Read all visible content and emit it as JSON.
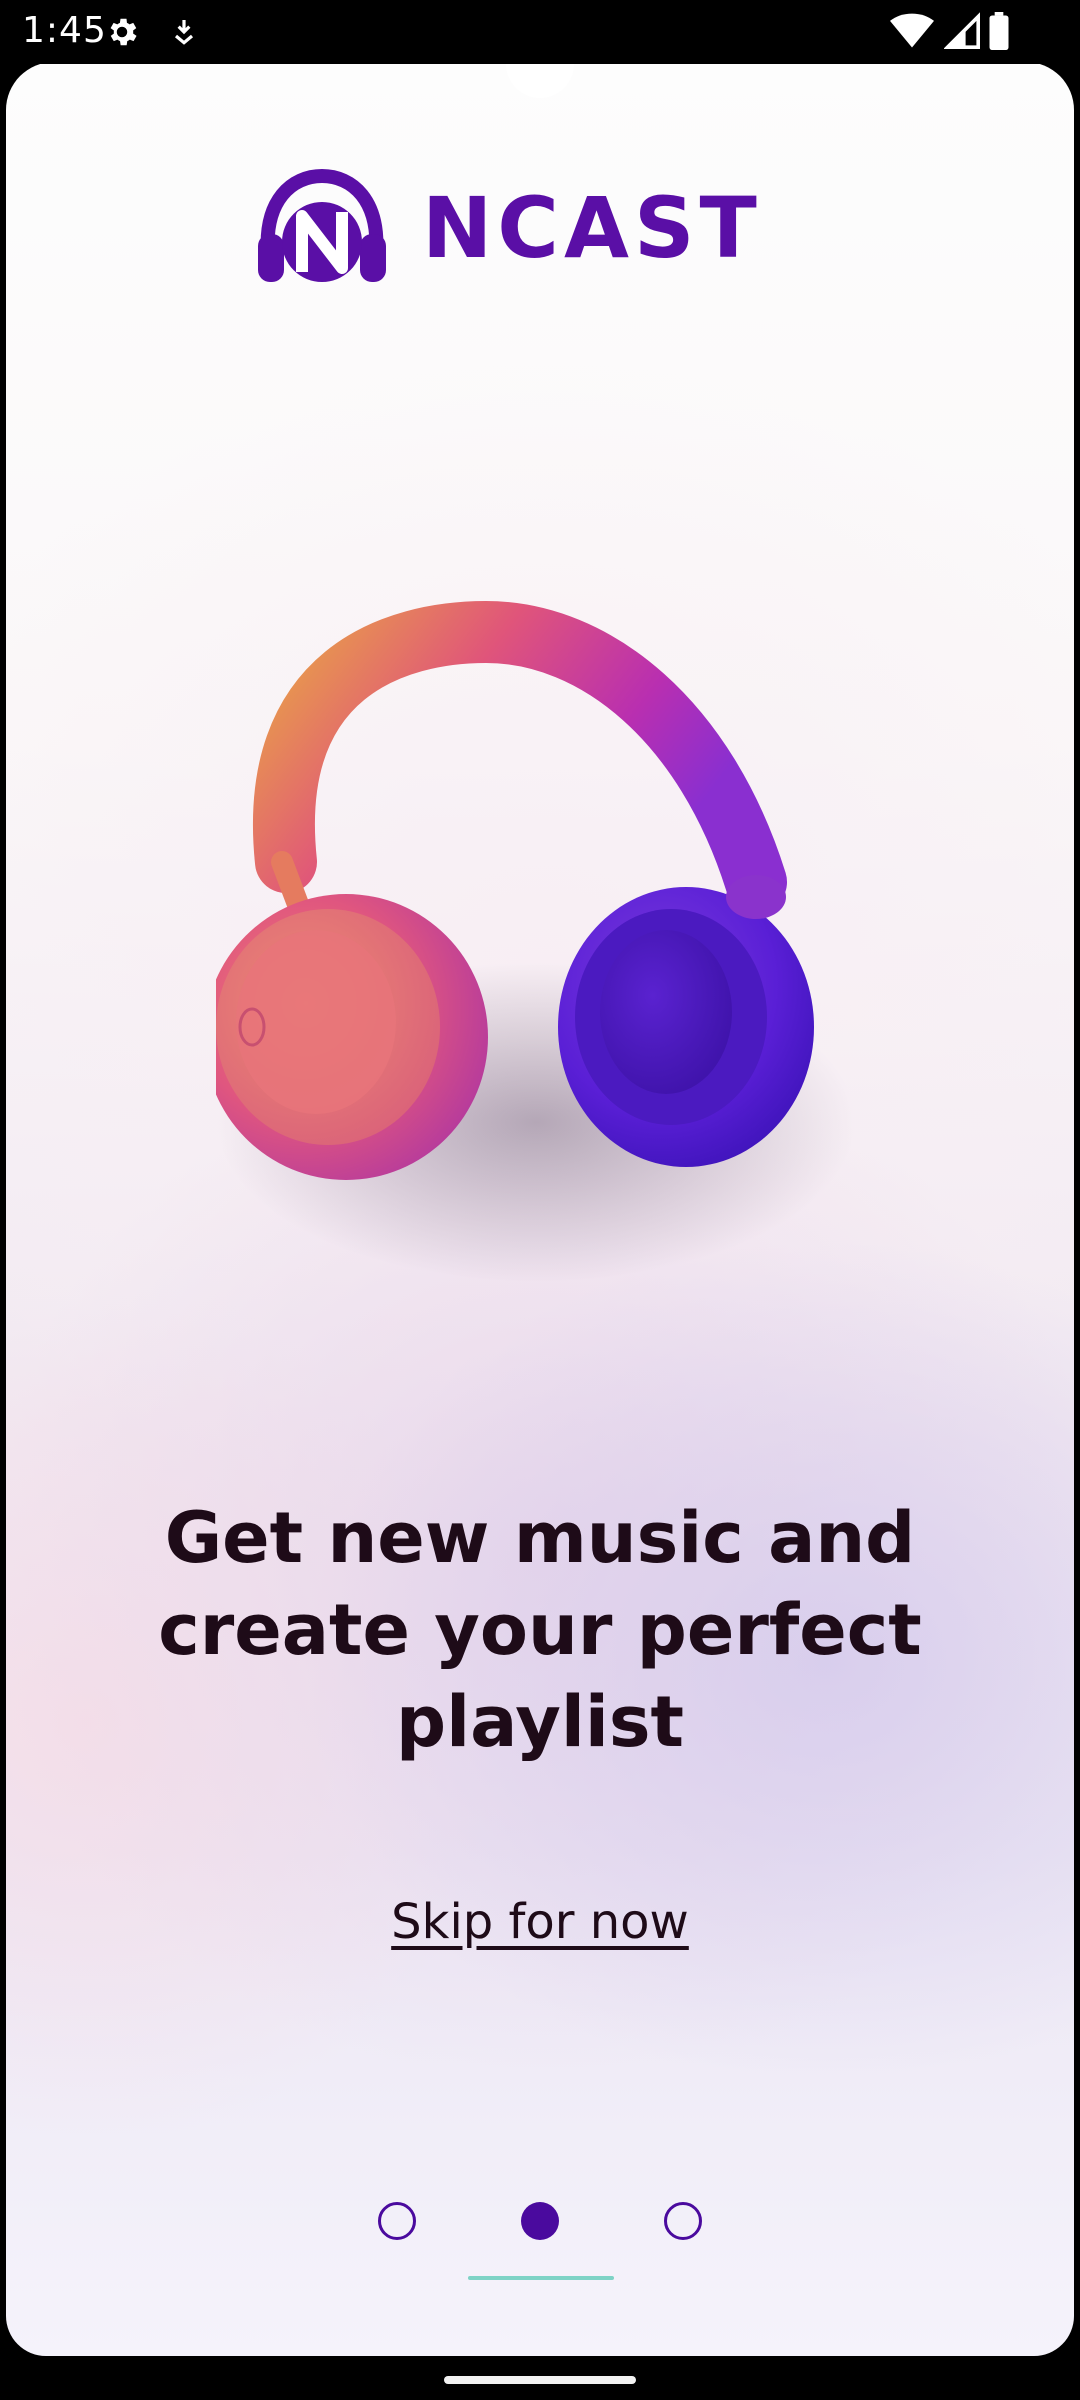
{
  "status_bar": {
    "time": "1:45",
    "left_icons": [
      "gear-icon",
      "download-icon"
    ],
    "right_icons": [
      "wifi-icon",
      "signal-icon",
      "battery-icon"
    ]
  },
  "app": {
    "brand": "NCAST",
    "brand_color": "#5a0fa6"
  },
  "onboarding": {
    "illustration": "headphones-illustration",
    "headline": "Get new music and create your perfect playlist",
    "skip_label": "Skip for now",
    "pager": {
      "total": 3,
      "active_index": 1,
      "dot_color": "#4a0a9e",
      "indicator_color": "#7fd3c6"
    }
  }
}
